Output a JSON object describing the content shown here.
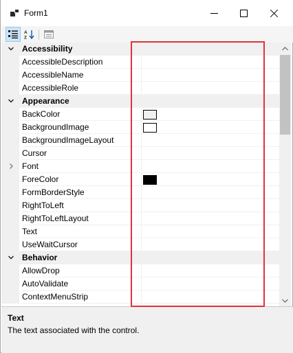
{
  "window": {
    "title": "Form1"
  },
  "toolbar": {
    "categorized_icon": "categorized-view-icon",
    "alphabetical_icon": "alphabetical-sort-icon",
    "property_pages_icon": "property-pages-icon"
  },
  "grid": {
    "rows": [
      {
        "type": "category",
        "label": "Accessibility",
        "expanded": true
      },
      {
        "type": "prop",
        "label": "AccessibleDescription",
        "value": ""
      },
      {
        "type": "prop",
        "label": "AccessibleName",
        "value": ""
      },
      {
        "type": "prop",
        "label": "AccessibleRole",
        "value": ""
      },
      {
        "type": "category",
        "label": "Appearance",
        "expanded": true
      },
      {
        "type": "prop",
        "label": "BackColor",
        "swatch": "#f0f0f0"
      },
      {
        "type": "prop",
        "label": "BackgroundImage",
        "swatch": "#ffffff"
      },
      {
        "type": "prop",
        "label": "BackgroundImageLayout",
        "value": ""
      },
      {
        "type": "prop",
        "label": "Cursor",
        "value": ""
      },
      {
        "type": "prop",
        "label": "Font",
        "value": "",
        "expandable": true
      },
      {
        "type": "prop",
        "label": "ForeColor",
        "swatch": "#000000"
      },
      {
        "type": "prop",
        "label": "FormBorderStyle",
        "value": ""
      },
      {
        "type": "prop",
        "label": "RightToLeft",
        "value": ""
      },
      {
        "type": "prop",
        "label": "RightToLeftLayout",
        "value": ""
      },
      {
        "type": "prop",
        "label": "Text",
        "value": ""
      },
      {
        "type": "prop",
        "label": "UseWaitCursor",
        "value": ""
      },
      {
        "type": "category",
        "label": "Behavior",
        "expanded": true
      },
      {
        "type": "prop",
        "label": "AllowDrop",
        "value": ""
      },
      {
        "type": "prop",
        "label": "AutoValidate",
        "value": ""
      },
      {
        "type": "prop",
        "label": "ContextMenuStrip",
        "value": ""
      }
    ]
  },
  "help": {
    "title": "Text",
    "description": "The text associated with the control."
  },
  "colors": {
    "highlight_border": "#e0313b",
    "category_bg": "#f0f0f0",
    "toolbar_active": "#cce4f7"
  }
}
